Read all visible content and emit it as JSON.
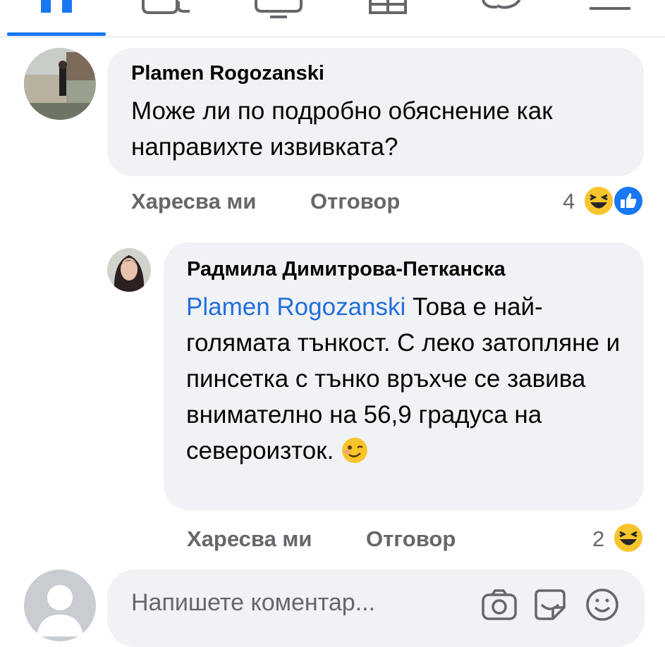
{
  "nav": {
    "items": [
      "home-icon",
      "friends-icon",
      "watch-icon",
      "marketplace-icon",
      "notifications-icon",
      "menu-icon"
    ]
  },
  "comment": {
    "author": "Plamen Rogozanski",
    "text": "Може ли по подробно обяснение как направихте извивката?",
    "like_label": "Харесва ми",
    "reply_label": "Отговор",
    "reaction_count": "4",
    "reactions": [
      "haha-icon",
      "like-icon"
    ]
  },
  "reply": {
    "author": "Радмила Димитрова-Петканска",
    "mention": "Plamen Rogozanski",
    "text": "Това е най-голямата тънкост. С леко затопляне и пинсетка с тънко връхче се завива внимателно на 56,9 градуса на североизток.",
    "emoji": "wink-emoji",
    "like_label": "Харесва ми",
    "reply_label": "Отговор",
    "reaction_count": "2",
    "reactions": [
      "haha-icon"
    ]
  },
  "composer": {
    "placeholder": "Напишете коментар...",
    "icons": [
      "camera-icon",
      "sticker-icon",
      "emoji-icon"
    ]
  },
  "colors": {
    "accent": "#1877f2",
    "mention": "#216fdb",
    "bubble": "#f0f2f5",
    "secondary_text": "#65676b"
  }
}
